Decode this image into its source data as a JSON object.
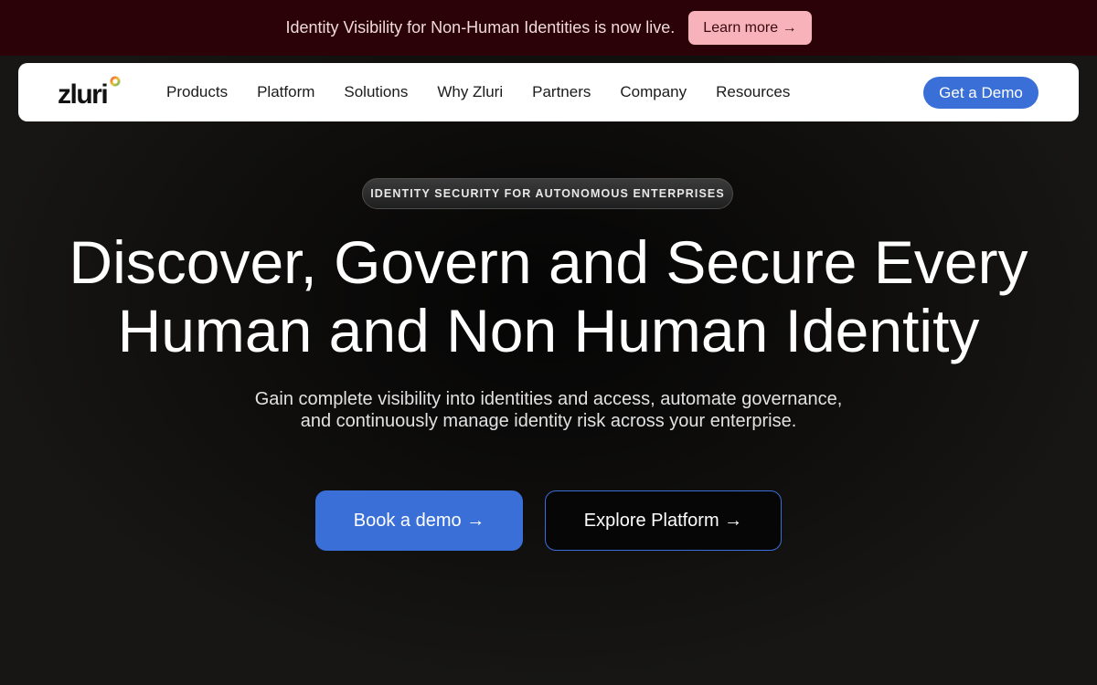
{
  "announcement": {
    "text": "Identity Visibility for Non-Human Identities is now live.",
    "cta": "Learn more →"
  },
  "nav": {
    "logo_text": "zluri",
    "items": [
      {
        "label": "Products"
      },
      {
        "label": "Platform"
      },
      {
        "label": "Solutions"
      },
      {
        "label": "Why Zluri"
      },
      {
        "label": "Partners"
      },
      {
        "label": "Company"
      },
      {
        "label": "Resources"
      }
    ],
    "cta": "Get a Demo"
  },
  "hero": {
    "eyebrow": "IDENTITY SECURITY FOR AUTONOMOUS ENTERPRISES",
    "headline_line1": "Discover, Govern and Secure Every",
    "headline_line2": "Human and Non Human Identity",
    "subtext_line1": "Gain complete visibility into identities and access, automate governance,",
    "subtext_line2": "and continuously manage identity risk across your enterprise.",
    "primary_cta": "Book a demo →",
    "secondary_cta": "Explore Platform →"
  },
  "colors": {
    "announcement_bg": "#2a0208",
    "announcement_button": "#f7b3b9",
    "accent_blue": "#3a6fd8",
    "page_bg": "#171614",
    "logo_dot_gradient": [
      "#e8423a",
      "#f2c12e",
      "#3cb878"
    ]
  }
}
